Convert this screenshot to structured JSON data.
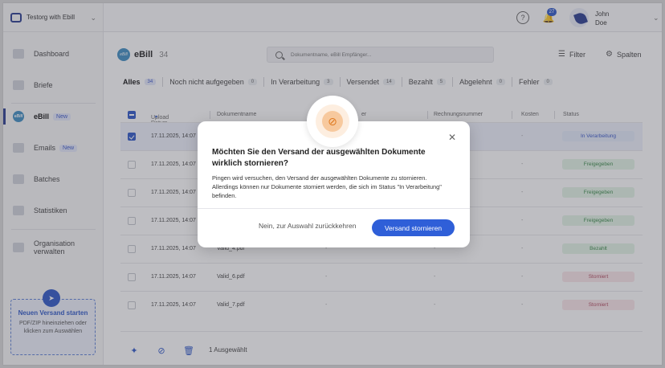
{
  "org": {
    "name": "Testorg with Ebill"
  },
  "user": {
    "first": "John",
    "last": "Doe",
    "notifications": "27"
  },
  "nav": [
    {
      "label": "Dashboard",
      "badge": ""
    },
    {
      "label": "Briefe",
      "badge": ""
    },
    {
      "label": "eBill",
      "badge": "New"
    },
    {
      "label": "Emails",
      "badge": "New"
    },
    {
      "label": "Batches",
      "badge": ""
    },
    {
      "label": "Statistiken",
      "badge": ""
    },
    {
      "label": "Organisation verwalten",
      "badge": ""
    }
  ],
  "upload": {
    "title": "Neuen Versand starten",
    "sub": "PDF/ZIP hineinziehen oder klicken zum Auswählen"
  },
  "page": {
    "title": "eBill",
    "count": "34"
  },
  "search": {
    "placeholder": "Dokumentname, eBill Empfänger..."
  },
  "toolbar": {
    "filter": "Filter",
    "columns": "Spalten"
  },
  "tabs": [
    {
      "label": "Alles",
      "count": "34"
    },
    {
      "label": "Noch nicht aufgegeben",
      "count": "0"
    },
    {
      "label": "In Verarbeitung",
      "count": "3"
    },
    {
      "label": "Versendet",
      "count": "14"
    },
    {
      "label": "Bezahlt",
      "count": "5"
    },
    {
      "label": "Abgelehnt",
      "count": "0"
    },
    {
      "label": "Fehler",
      "count": "0"
    }
  ],
  "table": {
    "headers": [
      "Upload Datum",
      "Dokumentname",
      "Rechnungsnummer",
      "Kosten",
      "Status"
    ],
    "header_partial": "er",
    "rows": [
      {
        "date": "17.11.2025, 14:07",
        "name": "",
        "d1": "",
        "d2": "",
        "d3": "-",
        "status": "In Verarbeitung",
        "tone": "blue",
        "selected": true
      },
      {
        "date": "17.11.2025, 14:07",
        "name": "",
        "d1": "",
        "d2": "",
        "d3": "-",
        "status": "Freigegeben",
        "tone": "green",
        "selected": false
      },
      {
        "date": "17.11.2025, 14:07",
        "name": "",
        "d1": "",
        "d2": "",
        "d3": "-",
        "status": "Freigegeben",
        "tone": "green",
        "selected": false
      },
      {
        "date": "17.11.2025, 14:07",
        "name": "",
        "d1": "",
        "d2": "",
        "d3": "-",
        "status": "Freigegeben",
        "tone": "green",
        "selected": false
      },
      {
        "date": "17.11.2025, 14:07",
        "name": "Valid_4.pdf",
        "d1": "-",
        "d2": "-",
        "d3": "-",
        "status": "Bezahlt",
        "tone": "green",
        "selected": false
      },
      {
        "date": "17.11.2025, 14:07",
        "name": "Valid_6.pdf",
        "d1": "-",
        "d2": "-",
        "d3": "-",
        "status": "Storniert",
        "tone": "red",
        "selected": false
      },
      {
        "date": "17.11.2025, 14:07",
        "name": "Valid_7.pdf",
        "d1": "-",
        "d2": "-",
        "d3": "-",
        "status": "Storniert",
        "tone": "red",
        "selected": false
      }
    ]
  },
  "bottom": {
    "selected": "1 Ausgewählt"
  },
  "modal": {
    "title": "Möchten Sie den Versand der ausgewählten Dokumente wirklich stornieren?",
    "body": "Pingen wird versuchen, den Versand der ausgewählten Dokumente zu stornieren. Allerdings können nur Dokumente storniert werden, die sich im Status \"In Verarbeitung\" befinden.",
    "cancel": "Nein, zur Auswahl zurückkehren",
    "confirm": "Versand stornieren"
  },
  "colors": {
    "accent": "#2f5fd8",
    "brand": "#2a3d8f",
    "warning": "#e07b22"
  }
}
